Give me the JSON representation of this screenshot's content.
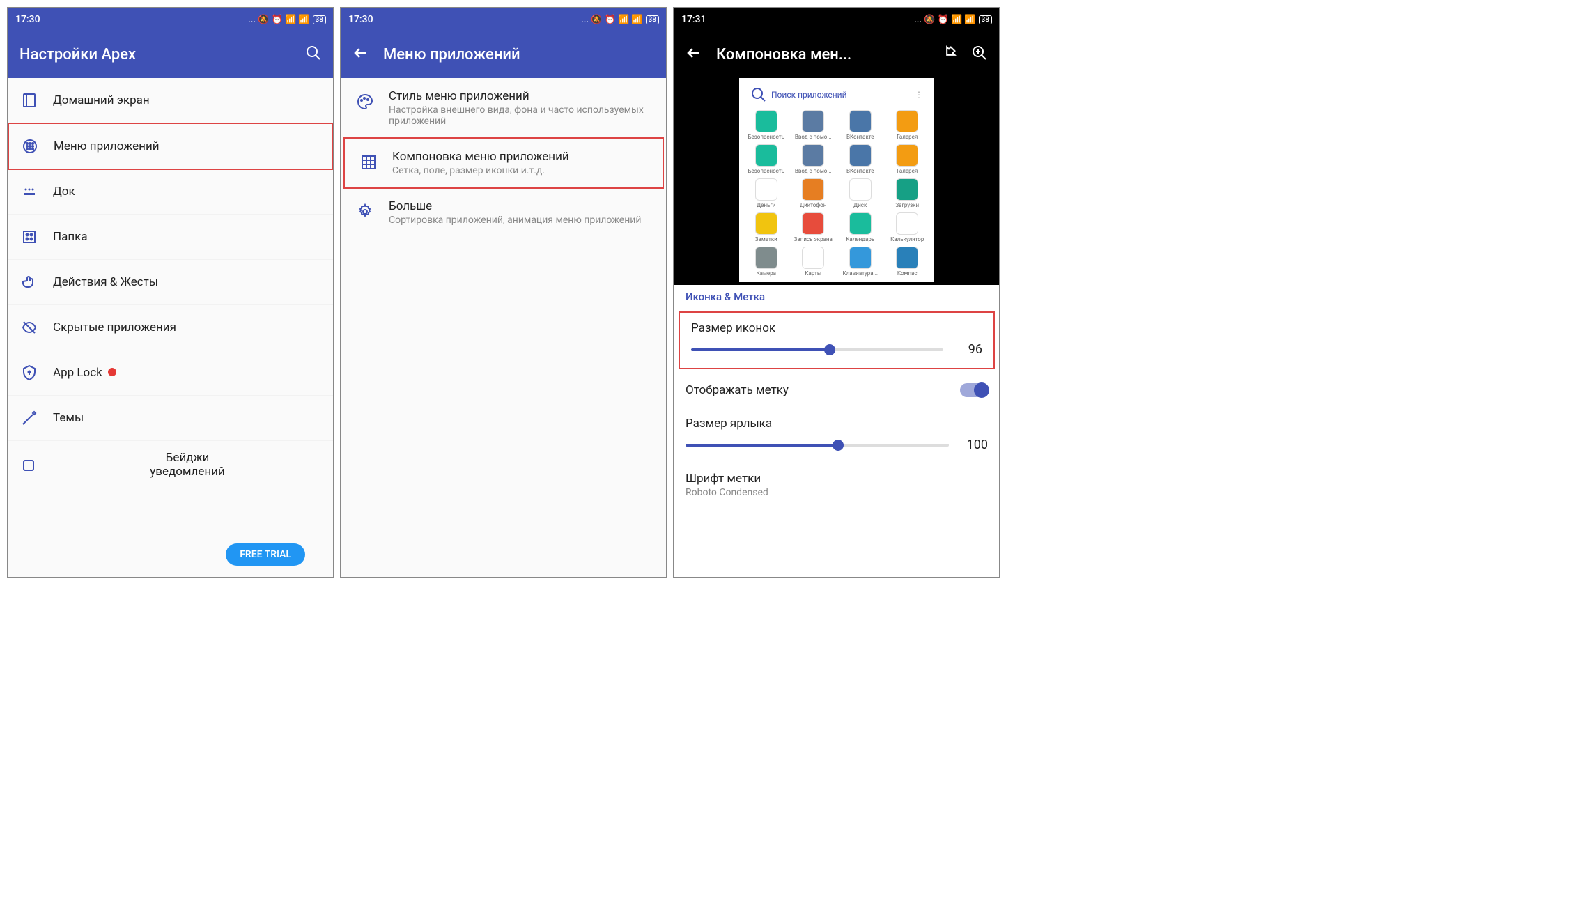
{
  "status": {
    "time1": "17:30",
    "time2": "17:30",
    "time3": "17:31",
    "battery": "38",
    "icons": "... ⌀ ⏰ 📶 📶"
  },
  "screen1": {
    "title": "Настройки Apex",
    "items": [
      {
        "label": "Домашний экран"
      },
      {
        "label": "Меню приложений",
        "highlight": true
      },
      {
        "label": "Док"
      },
      {
        "label": "Папка"
      },
      {
        "label": "Действия & Жесты"
      },
      {
        "label": "Скрытые приложения"
      },
      {
        "label": "App Lock",
        "dot": true
      },
      {
        "label": "Темы"
      }
    ],
    "badges_label": "Бейджи\nуведомлений",
    "trial": "FREE TRIAL"
  },
  "screen2": {
    "title": "Меню приложений",
    "items": [
      {
        "title": "Стиль меню приложений",
        "sub": "Настройка внешнего вида, фона и часто используемых приложений"
      },
      {
        "title": "Компоновка меню приложений",
        "sub": "Сетка, поле, размер иконки и.т.д.",
        "highlight": true
      },
      {
        "title": "Больше",
        "sub": "Сортировка приложений, анимация меню приложений"
      }
    ]
  },
  "screen3": {
    "title": "Компоновка мен...",
    "preview_search": "Поиск приложений",
    "preview_apps": [
      {
        "label": "Безопасность",
        "color": "#1abc9c"
      },
      {
        "label": "Ввод с помо...",
        "color": "#5b7ba3"
      },
      {
        "label": "ВКонтакте",
        "color": "#4a76a8"
      },
      {
        "label": "Галерея",
        "color": "#f39c12"
      },
      {
        "label": "Безопасность",
        "color": "#1abc9c"
      },
      {
        "label": "Ввод с помо...",
        "color": "#5b7ba3"
      },
      {
        "label": "ВКонтакте",
        "color": "#4a76a8"
      },
      {
        "label": "Галерея",
        "color": "#f39c12"
      },
      {
        "label": "Деньги",
        "color": "#fff"
      },
      {
        "label": "Диктофон",
        "color": "#e67e22"
      },
      {
        "label": "Диск",
        "color": "#fff"
      },
      {
        "label": "Загрузки",
        "color": "#16a085"
      },
      {
        "label": "Заметки",
        "color": "#f1c40f"
      },
      {
        "label": "Запись экрана",
        "color": "#e74c3c"
      },
      {
        "label": "Календарь",
        "color": "#1abc9c"
      },
      {
        "label": "Калькулятор",
        "color": "#fff"
      },
      {
        "label": "Камера",
        "color": "#7f8c8d"
      },
      {
        "label": "Карты",
        "color": "#fff"
      },
      {
        "label": "Клавиатура...",
        "color": "#3498db"
      },
      {
        "label": "Компас",
        "color": "#2980b9"
      }
    ],
    "section": "Иконка & Метка",
    "icon_size_label": "Размер иконок",
    "icon_size_value": "96",
    "show_label": "Отображать метку",
    "label_size_label": "Размер ярлыка",
    "label_size_value": "100",
    "font_label": "Шрифт метки",
    "font_value": "Roboto Condensed"
  }
}
